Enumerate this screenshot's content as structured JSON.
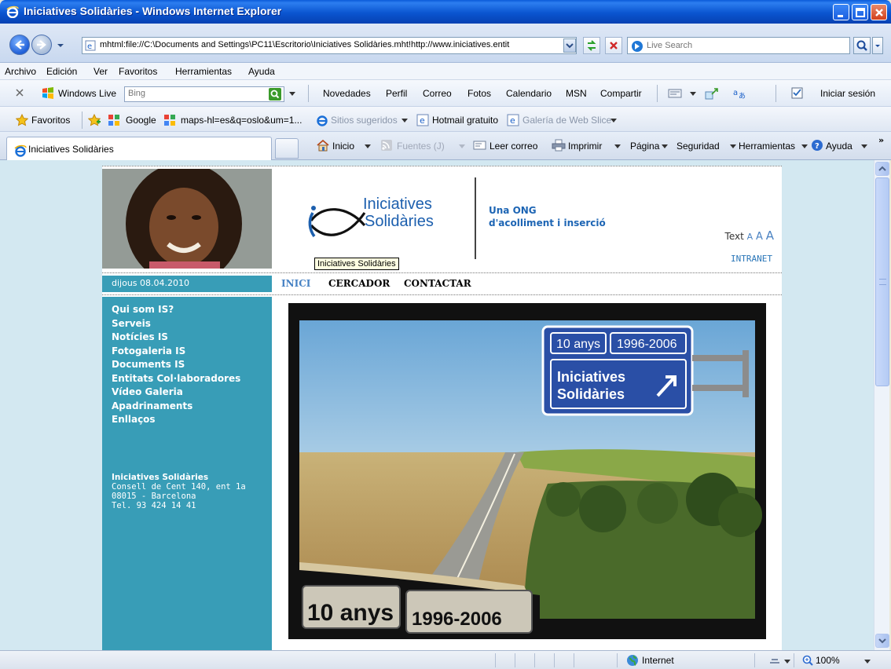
{
  "window": {
    "title": "Iniciatives Solidàries - Windows Internet Explorer"
  },
  "address": {
    "url": "mhtml:file://C:\\Documents and Settings\\PC11\\Escritorio\\Iniciatives Solidàries.mht!http://www.iniciatives.entit",
    "search_placeholder": "Live Search"
  },
  "menu": [
    "Archivo",
    "Edición",
    "Ver",
    "Favoritos",
    "Herramientas",
    "Ayuda"
  ],
  "live_toolbar": {
    "brand": "Windows Live",
    "search_placeholder": "Bing",
    "links": [
      "Novedades",
      "Perfil",
      "Correo",
      "Fotos",
      "Calendario",
      "MSN",
      "Compartir"
    ],
    "signin": "Iniciar sesión"
  },
  "favorites_bar": {
    "favorites": "Favoritos",
    "items": [
      "Google",
      "maps-hl=es&q=oslo&um=1...",
      "Sitios sugeridos",
      "Hotmail gratuito",
      "Galería de Web Slice"
    ]
  },
  "tab": {
    "label": "Iniciatives Solidàries"
  },
  "command_bar": {
    "home": "Inicio",
    "feeds": "Fuentes (J)",
    "mail": "Leer correo",
    "print": "Imprimir",
    "page": "Página",
    "safety": "Seguridad",
    "tools": "Herramientas",
    "help": "Ayuda"
  },
  "site": {
    "logo_line1": "Iniciatives",
    "logo_line2": "Solidàries",
    "tagline_line1": "Una ONG",
    "tagline_line2": "d'acolliment i inserció",
    "text_size_label": "Text",
    "text_size_a": "A",
    "intranet": "INTRANET",
    "tooltip": "Iniciatives Solidàries",
    "date": "dijous 08.04.2010",
    "top_nav": [
      "INICI",
      "CERCADOR",
      "CONTACTAR"
    ],
    "side_menu": [
      "Qui som IS?",
      "Serveis",
      "Notícies IS",
      "Fotogaleria IS",
      "Documents IS",
      "Entitats Col·laboradores",
      "Vídeo Galeria",
      "Apadrinaments",
      "Enllaços"
    ],
    "contact": {
      "name": "Iniciatives Solidàries",
      "street": "Consell de Cent 140, ent 1a",
      "city": "08015 - Barcelona",
      "phone": "Tel. 93 424 14 41"
    },
    "banner": {
      "sign_years": "10 anys",
      "sign_range": "1996-2006",
      "sign_line1": "Iniciatives",
      "sign_line2": "Solidàries",
      "bottom_years": "10 anys",
      "bottom_range": "1996-2006"
    }
  },
  "status": {
    "zone": "Internet",
    "zoom": "100%"
  }
}
